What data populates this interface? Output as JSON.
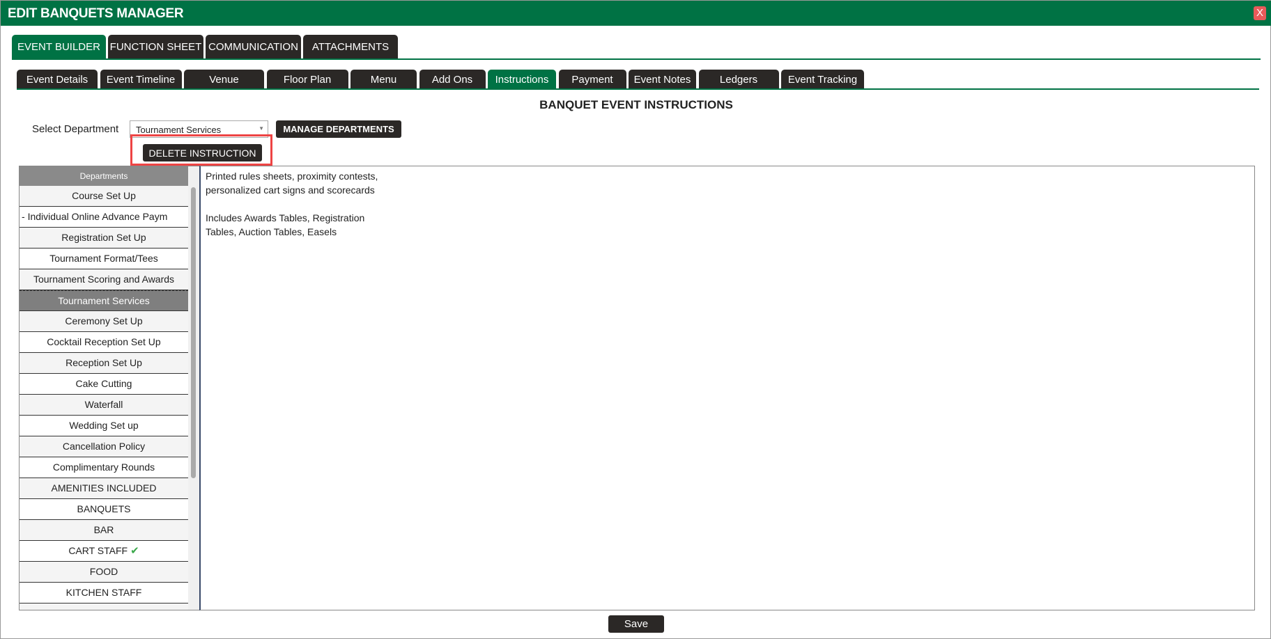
{
  "window": {
    "title": "EDIT BANQUETS MANAGER",
    "close_label": "X"
  },
  "main_tabs": [
    {
      "label": "EVENT BUILDER",
      "active": true
    },
    {
      "label": "FUNCTION SHEET"
    },
    {
      "label": "COMMUNICATION"
    },
    {
      "label": "ATTACHMENTS"
    }
  ],
  "sub_tabs": [
    {
      "label": "Event Details"
    },
    {
      "label": "Event Timeline"
    },
    {
      "label": "Venue"
    },
    {
      "label": "Floor Plan"
    },
    {
      "label": "Menu"
    },
    {
      "label": "Add Ons"
    },
    {
      "label": "Instructions",
      "active": true
    },
    {
      "label": "Payment"
    },
    {
      "label": "Event Notes"
    },
    {
      "label": "Ledgers"
    },
    {
      "label": "Event Tracking"
    }
  ],
  "page": {
    "heading": "BANQUET EVENT INSTRUCTIONS",
    "select_label": "Select Department",
    "select_value": "Tournament Services",
    "manage_label": "MANAGE DEPARTMENTS",
    "delete_label": "DELETE INSTRUCTION",
    "save_label": "Save"
  },
  "departments": {
    "header": "Departments",
    "items": [
      "Course Set Up",
      "ment - Individual Online Advance Paym",
      "Registration Set Up",
      "Tournament Format/Tees",
      "Tournament Scoring and Awards",
      "Tournament Services",
      "Ceremony Set Up",
      "Cocktail Reception Set Up",
      "Reception Set Up",
      "Cake Cutting",
      "Waterfall",
      "Wedding Set up",
      "Cancellation Policy",
      "Complimentary Rounds",
      "AMENITIES INCLUDED",
      "BANQUETS",
      "BAR",
      "CART STAFF",
      "FOOD",
      "KITCHEN STAFF",
      ""
    ],
    "selected": "Tournament Services",
    "checked": "CART STAFF"
  },
  "instruction_text": "Printed rules sheets, proximity contests,\npersonalized cart signs and scorecards\n\nIncludes Awards Tables, Registration\nTables, Auction Tables, Easels",
  "colors": {
    "brand": "#007244",
    "dark": "#2b2826",
    "highlight": "#ee4444"
  }
}
